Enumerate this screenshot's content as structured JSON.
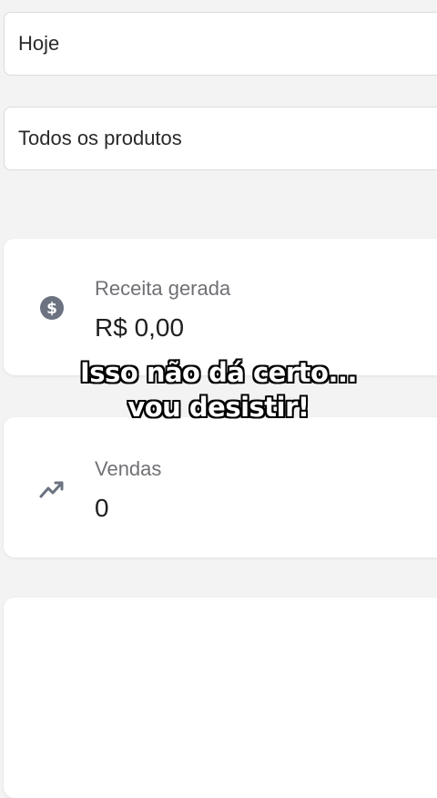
{
  "filters": {
    "period": "Hoje",
    "products": "Todos os produtos"
  },
  "stats": {
    "revenue": {
      "label": "Receita gerada",
      "value": "R$ 0,00",
      "icon": "dollar-coin-icon"
    },
    "sales": {
      "label": "Vendas",
      "value": "0",
      "icon": "trending-up-icon"
    }
  },
  "caption": {
    "line1": "Isso não dá certo...",
    "line2": "vou desistir!"
  },
  "colors": {
    "background": "#f3f3f4",
    "card": "#ffffff",
    "icon": "#6b7280",
    "label": "#707075"
  }
}
